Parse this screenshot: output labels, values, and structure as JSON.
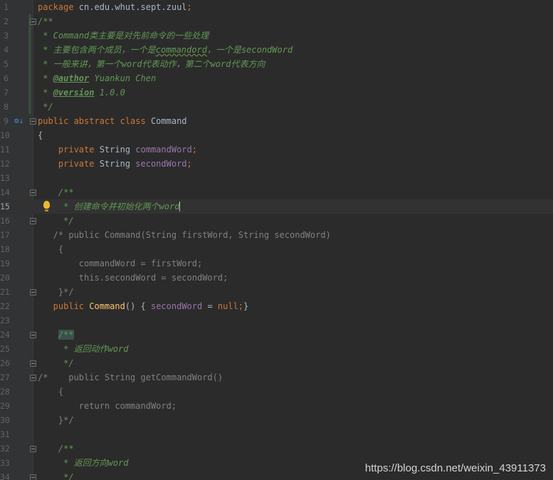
{
  "editor": {
    "current_line": "15",
    "lines": [
      {
        "n": "1",
        "t": [
          [
            "k",
            "package"
          ],
          [
            "p",
            " cn.edu.whut.sept.zuul"
          ],
          [
            "k",
            ";"
          ]
        ]
      },
      {
        "n": "2",
        "t": [
          [
            "d",
            "/**"
          ]
        ]
      },
      {
        "n": "3",
        "t": [
          [
            "d",
            " * Command类主要是对先前命令的一些处理"
          ]
        ]
      },
      {
        "n": "4",
        "t": [
          [
            "d",
            " * 主要包含两个成员，一个是"
          ],
          [
            "du",
            "commandord"
          ],
          [
            "d",
            "，一个是secondWord"
          ]
        ]
      },
      {
        "n": "5",
        "t": [
          [
            "d",
            " * 一般来讲，第一个word代表动作，第二个word代表方向"
          ]
        ]
      },
      {
        "n": "6",
        "t": [
          [
            "d",
            " * "
          ],
          [
            "dt",
            "@author"
          ],
          [
            "d",
            " Yuankun Chen"
          ]
        ]
      },
      {
        "n": "7",
        "t": [
          [
            "d",
            " * "
          ],
          [
            "dt",
            "@version"
          ],
          [
            "d",
            " 1.0.0"
          ]
        ]
      },
      {
        "n": "8",
        "t": [
          [
            "d",
            " */"
          ]
        ]
      },
      {
        "n": "9",
        "t": [
          [
            "k",
            "public abstract class"
          ],
          [
            "p",
            " Command"
          ]
        ]
      },
      {
        "n": "10",
        "t": [
          [
            "p",
            "{"
          ]
        ]
      },
      {
        "n": "11",
        "t": [
          [
            "k",
            "    private"
          ],
          [
            "p",
            " String "
          ],
          [
            "f",
            "commandWord"
          ],
          [
            "k",
            ";"
          ]
        ]
      },
      {
        "n": "12",
        "t": [
          [
            "k",
            "    private"
          ],
          [
            "p",
            " String "
          ],
          [
            "f",
            "secondWord"
          ],
          [
            "k",
            ";"
          ]
        ]
      },
      {
        "n": "13",
        "t": []
      },
      {
        "n": "14",
        "t": [
          [
            "d",
            "    /**"
          ]
        ]
      },
      {
        "n": "15",
        "t": [
          [
            "d",
            "     * 创建命令并初始化两个word"
          ]
        ]
      },
      {
        "n": "16",
        "t": [
          [
            "d",
            "     */"
          ]
        ]
      },
      {
        "n": "17",
        "t": [
          [
            "c",
            "   /* public Command(String firstWord, String secondWord)"
          ]
        ]
      },
      {
        "n": "18",
        "t": [
          [
            "c",
            "    {"
          ]
        ]
      },
      {
        "n": "19",
        "t": [
          [
            "c",
            "        commandWord = firstWord;"
          ]
        ]
      },
      {
        "n": "20",
        "t": [
          [
            "c",
            "        this.secondWord = secondWord;"
          ]
        ]
      },
      {
        "n": "21",
        "t": [
          [
            "c",
            "    }*/"
          ]
        ]
      },
      {
        "n": "22",
        "t": [
          [
            "k",
            "   public"
          ],
          [
            "p",
            " "
          ],
          [
            "fn",
            "Command"
          ],
          [
            "p",
            "() { "
          ],
          [
            "f",
            "secondWord"
          ],
          [
            "p",
            " = "
          ],
          [
            "k",
            "null;"
          ],
          [
            "p",
            "}"
          ]
        ]
      },
      {
        "n": "23",
        "t": []
      },
      {
        "n": "24",
        "t": [
          [
            "p",
            "    "
          ],
          [
            "dh",
            "/**"
          ]
        ]
      },
      {
        "n": "25",
        "t": [
          [
            "d",
            "     * 返回动作word"
          ]
        ]
      },
      {
        "n": "26",
        "t": [
          [
            "d",
            "     */"
          ]
        ]
      },
      {
        "n": "27",
        "t": [
          [
            "c",
            "/*    public String getCommandWord()"
          ]
        ]
      },
      {
        "n": "28",
        "t": [
          [
            "c",
            "    {"
          ]
        ]
      },
      {
        "n": "29",
        "t": [
          [
            "c",
            "        return commandWord;"
          ]
        ]
      },
      {
        "n": "30",
        "t": [
          [
            "c",
            "    }*/"
          ]
        ]
      },
      {
        "n": "31",
        "t": []
      },
      {
        "n": "32",
        "t": [
          [
            "d",
            "    /**"
          ]
        ]
      },
      {
        "n": "33",
        "t": [
          [
            "d",
            "     * 返回方向word"
          ]
        ]
      },
      {
        "n": "34",
        "t": [
          [
            "d",
            "     */"
          ]
        ]
      }
    ],
    "fold_lines": [
      "2",
      "9",
      "14",
      "16",
      "21",
      "24",
      "26",
      "27",
      "32",
      "34"
    ],
    "change_marker_lines": [
      "2",
      "3",
      "4",
      "5",
      "6",
      "7",
      "8"
    ],
    "gutter_icon": {
      "line": "9",
      "icon": "implemented-overridden-icon",
      "glyph": "⚙↓"
    },
    "intention_icon": {
      "line": "15",
      "icon": "lightbulb-icon"
    }
  },
  "watermark": "https://blog.csdn.net/weixin_43911373"
}
